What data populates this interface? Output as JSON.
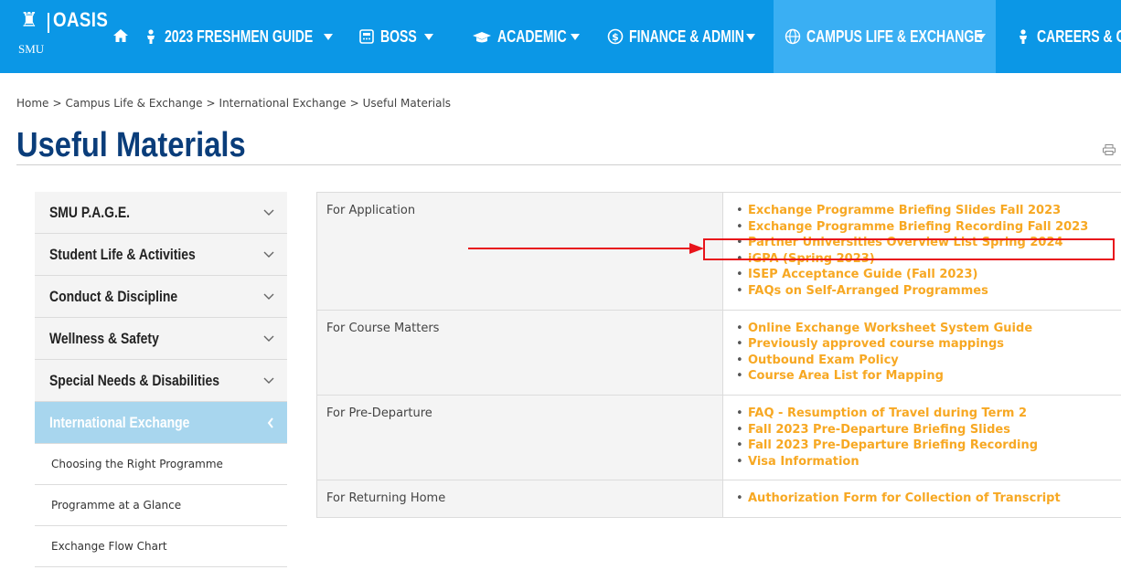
{
  "header": {
    "logo_name": "OASIS",
    "logo_sub": "SMU",
    "nav": [
      {
        "label": "2023 FRESHMEN GUIDE",
        "icon": "person-icon"
      },
      {
        "label": "BOSS",
        "icon": "calculator-icon"
      },
      {
        "label": "ACADEMIC",
        "icon": "graduation-cap-icon"
      },
      {
        "label": "FINANCE & ADMIN",
        "icon": "dollar-circle-icon"
      },
      {
        "label": "CAMPUS LIFE & EXCHANGE",
        "icon": "globe-icon",
        "active": true
      },
      {
        "label": "CAREERS & COM",
        "icon": "person-icon"
      }
    ]
  },
  "breadcrumb": [
    "Home",
    "Campus Life & Exchange",
    "International Exchange",
    "Useful Materials"
  ],
  "breadcrumb_sep": ">",
  "page": {
    "title": "Useful Materials"
  },
  "sidebar": {
    "items": [
      {
        "label": "SMU P.A.G.E."
      },
      {
        "label": "Student Life & Activities"
      },
      {
        "label": "Conduct & Discipline"
      },
      {
        "label": "Wellness & Safety"
      },
      {
        "label": "Special Needs & Disabilities"
      },
      {
        "label": "International Exchange",
        "active": true
      }
    ],
    "sub_items": [
      {
        "label": "Choosing the Right Programme"
      },
      {
        "label": "Programme at a Glance"
      },
      {
        "label": "Exchange Flow Chart"
      }
    ]
  },
  "materials": [
    {
      "category": "For Application",
      "links": [
        "Exchange Programme Briefing Slides Fall 2023",
        "Exchange Programme Briefing Recording Fall 2023",
        "Partner Universities Overview List Spring 2024",
        "iGPA (Spring 2023)",
        "ISEP Acceptance Guide (Fall 2023)",
        "FAQs on Self-Arranged Programmes"
      ]
    },
    {
      "category": "For Course Matters",
      "links": [
        "Online Exchange Worksheet System Guide",
        "Previously approved course mappings",
        "Outbound Exam Policy",
        "Course Area List for Mapping"
      ]
    },
    {
      "category": "For Pre-Departure",
      "links": [
        "FAQ - Resumption of Travel during Term 2",
        "Fall 2023 Pre-Departure Briefing Slides",
        "Fall 2023 Pre-Departure Briefing Recording",
        "Visa Information"
      ]
    },
    {
      "category": "For Returning Home",
      "links": [
        "Authorization Form for Collection of Transcript"
      ]
    }
  ],
  "colors": {
    "nav_bg": "#0b97e6",
    "nav_active": "#3aaff3",
    "title": "#0a3d7a",
    "link": "#f7a823",
    "sidebar_active": "#a8d6ee",
    "annotation": "#e8141b"
  }
}
